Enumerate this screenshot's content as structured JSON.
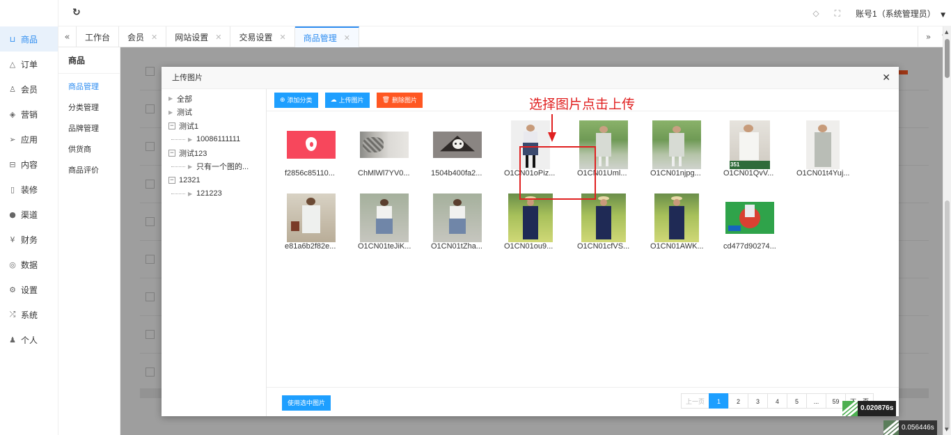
{
  "leftnav": {
    "items": [
      {
        "icon": "cart-icon",
        "glyph": "⊔",
        "label": "商品",
        "active": true
      },
      {
        "icon": "bell-icon",
        "glyph": "△",
        "label": "订单"
      },
      {
        "icon": "user-icon",
        "glyph": "♙",
        "label": "会员"
      },
      {
        "icon": "box-icon",
        "glyph": "◈",
        "label": "营销"
      },
      {
        "icon": "send-icon",
        "glyph": "➢",
        "label": "应用"
      },
      {
        "icon": "truck-icon",
        "glyph": "⊟",
        "label": "内容"
      },
      {
        "icon": "mobile-icon",
        "glyph": "▯",
        "label": "装修"
      },
      {
        "icon": "wechat-icon",
        "glyph": "●",
        "label": "渠道"
      },
      {
        "icon": "yen-icon",
        "glyph": "¥",
        "label": "财务"
      },
      {
        "icon": "globe-icon",
        "glyph": "◎",
        "label": "数据"
      },
      {
        "icon": "gear-icon",
        "glyph": "⚙",
        "label": "设置"
      },
      {
        "icon": "shuffle-icon",
        "glyph": "⤮",
        "label": "系统"
      },
      {
        "icon": "person-icon",
        "glyph": "♟",
        "label": "个人"
      }
    ]
  },
  "topbar": {
    "account": "账号1（系统管理员）"
  },
  "tabs": [
    {
      "label": "工作台",
      "closable": false
    },
    {
      "label": "会员",
      "closable": true
    },
    {
      "label": "网站设置",
      "closable": true
    },
    {
      "label": "交易设置",
      "closable": true
    },
    {
      "label": "商品管理",
      "closable": true,
      "active": true
    }
  ],
  "subnav": {
    "title": "商品",
    "items": [
      {
        "label": "商品管理",
        "active": true
      },
      {
        "label": "分类管理"
      },
      {
        "label": "品牌管理"
      },
      {
        "label": "供货商"
      },
      {
        "label": "商品评价"
      }
    ]
  },
  "modal": {
    "title": "上传图片",
    "tree": [
      {
        "label": "全部",
        "type": "leaf-root"
      },
      {
        "label": "测试",
        "type": "leaf-root"
      },
      {
        "label": "测试1",
        "type": "expanded"
      },
      {
        "label": "10086111111",
        "type": "child"
      },
      {
        "label": "测试123",
        "type": "expanded"
      },
      {
        "label": "只有一个图的...",
        "type": "child"
      },
      {
        "label": "12321",
        "type": "expanded"
      },
      {
        "label": "121223",
        "type": "child"
      }
    ],
    "toolbar": {
      "add_category": "添加分类",
      "upload": "上传图片",
      "delete": "删除图片"
    },
    "images": [
      {
        "name": "f2856c85110...",
        "kind": "pink-logo"
      },
      {
        "name": "ChMlWl7YV0...",
        "kind": "gray-cat"
      },
      {
        "name": "1504b400fa2...",
        "kind": "cat-box"
      },
      {
        "name": "O1CN01oPiz...",
        "kind": "fashion-a"
      },
      {
        "name": "O1CN01Uml...",
        "kind": "fashion-green"
      },
      {
        "name": "O1CN01njpg...",
        "kind": "fashion-green"
      },
      {
        "name": "O1CN01QvV...",
        "kind": "fashion-white",
        "badge": "351"
      },
      {
        "name": "O1CN01t4Yuj...",
        "kind": "fashion-gray"
      },
      {
        "name": "e81a6b2f82e...",
        "kind": "fashion-beige"
      },
      {
        "name": "O1CN01teJiK...",
        "kind": "fashion-street"
      },
      {
        "name": "O1CN01tZha...",
        "kind": "fashion-street"
      },
      {
        "name": "O1CN01ou9...",
        "kind": "field-navy"
      },
      {
        "name": "O1CN01cfVS...",
        "kind": "field-navy"
      },
      {
        "name": "O1CN01AWK...",
        "kind": "field-navy"
      },
      {
        "name": "cd477d90274...",
        "kind": "green-game"
      }
    ],
    "use_selected": "使用选中图片",
    "pagination": [
      "上一页",
      "1",
      "2",
      "3",
      "4",
      "5",
      "...",
      "59",
      "下一页"
    ],
    "current_page": "1"
  },
  "annotation": {
    "text": "选择图片点击上传"
  },
  "timers": {
    "inner": "0.020876s",
    "outer": "0.056446s"
  },
  "colors": {
    "accent": "#2d8cf0",
    "button_blue": "#1e9fff",
    "button_red": "#ff5722",
    "annotation_red": "#e02020"
  }
}
